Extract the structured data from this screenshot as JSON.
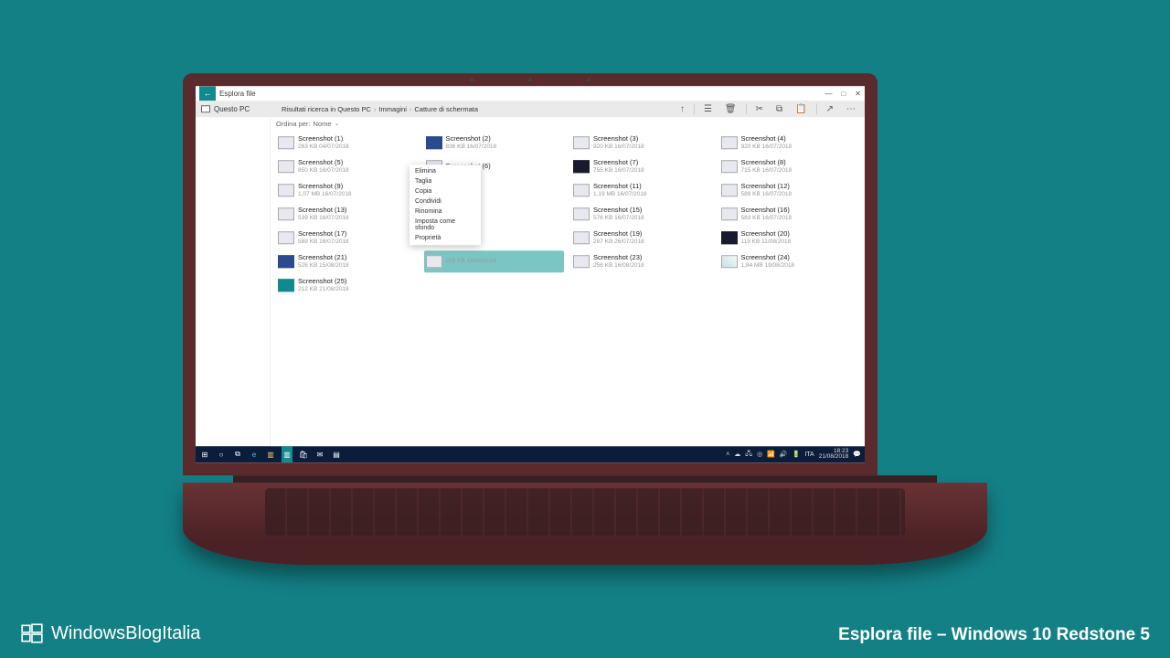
{
  "brand": "WindowsBlogItalia",
  "caption": "Esplora file – Windows 10 Redstone 5",
  "window": {
    "title": "Esplora file",
    "sidebar_label": "Questo PC",
    "breadcrumb": [
      "Risultati ricerca in Questo PC",
      "Immagini",
      "Catture di schermata"
    ],
    "sort_prefix": "Ordina per:",
    "sort_value": "Nome"
  },
  "context_menu": [
    "Elimina",
    "Taglia",
    "Copia",
    "Condividi",
    "Rinomina",
    "Imposta come sfondo",
    "Proprietà"
  ],
  "files": [
    {
      "name": "Screenshot (1)",
      "meta": "263 KB 04/07/2018",
      "t": "light"
    },
    {
      "name": "Screenshot (2)",
      "meta": "836 KB 16/07/2018",
      "t": "blue"
    },
    {
      "name": "Screenshot (3)",
      "meta": "920 KB 16/07/2018",
      "t": "light"
    },
    {
      "name": "Screenshot (4)",
      "meta": "920 KB 16/07/2018",
      "t": "light"
    },
    {
      "name": "Screenshot (5)",
      "meta": "850 KB 16/07/2018",
      "t": "light"
    },
    {
      "name": "Screenshot (6)",
      "meta": "",
      "t": "light"
    },
    {
      "name": "Screenshot (7)",
      "meta": "755 KB 16/07/2018",
      "t": "dark"
    },
    {
      "name": "Screenshot (8)",
      "meta": "715 KB 16/07/2018",
      "t": "light"
    },
    {
      "name": "Screenshot (9)",
      "meta": "1,07 MB 16/07/2018",
      "t": "light"
    },
    {
      "name": "",
      "meta": "",
      "t": "light"
    },
    {
      "name": "Screenshot (11)",
      "meta": "1,19 MB 16/07/2018",
      "t": "light"
    },
    {
      "name": "Screenshot (12)",
      "meta": "589 KB 16/07/2018",
      "t": "light"
    },
    {
      "name": "Screenshot (13)",
      "meta": "539 KB 16/07/2018",
      "t": "light"
    },
    {
      "name": "",
      "meta": "",
      "t": "light"
    },
    {
      "name": "Screenshot (15)",
      "meta": "576 KB 16/07/2018",
      "t": "light"
    },
    {
      "name": "Screenshot (16)",
      "meta": "583 KB 16/07/2018",
      "t": "light"
    },
    {
      "name": "Screenshot (17)",
      "meta": "589 KB 16/07/2018",
      "t": "light"
    },
    {
      "name": "",
      "meta": "",
      "t": "light"
    },
    {
      "name": "Screenshot (19)",
      "meta": "287 KB 26/07/2018",
      "t": "light"
    },
    {
      "name": "Screenshot (20)",
      "meta": "119 KB 11/08/2018",
      "t": "dark"
    },
    {
      "name": "Screenshot (21)",
      "meta": "526 KB 15/08/2018",
      "t": "blue"
    },
    {
      "name": "",
      "meta": "256 KB 16/08/2018",
      "t": "light",
      "selected": true
    },
    {
      "name": "Screenshot (23)",
      "meta": "256 KB 16/08/2018",
      "t": "light"
    },
    {
      "name": "Screenshot (24)",
      "meta": "1,84 MB 19/08/2018",
      "t": "map"
    },
    {
      "name": "Screenshot (25)",
      "meta": "212 KB 21/08/2018",
      "t": "teal"
    }
  ],
  "taskbar": {
    "lang": "ITA",
    "time": "18:23",
    "date": "21/08/2018"
  }
}
